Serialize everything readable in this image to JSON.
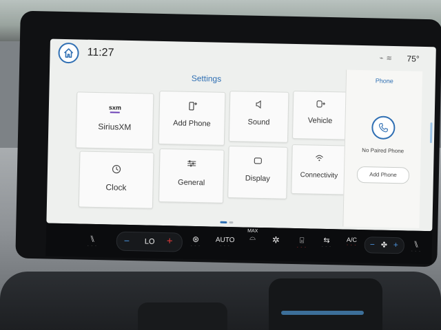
{
  "status_bar": {
    "time": "11:27",
    "outside_temp": "75°",
    "home_icon": "home-icon",
    "status_icons": "wifi-icon, signal-icon"
  },
  "settings": {
    "title": "Settings",
    "tiles": [
      {
        "label": "SiriusXM",
        "icon": "sxm"
      },
      {
        "label": "Add Phone",
        "icon": "phone-add-icon"
      },
      {
        "label": "Sound",
        "icon": "speaker-icon"
      },
      {
        "label": "Vehicle",
        "icon": "vehicle-icon"
      },
      {
        "label": "Clock",
        "icon": "clock-icon"
      },
      {
        "label": "General",
        "icon": "sliders-icon"
      },
      {
        "label": "Display",
        "icon": "display-icon"
      },
      {
        "label": "Connectivity",
        "icon": "wifi-icon"
      }
    ]
  },
  "phone_panel": {
    "title": "Phone",
    "status": "No Paired Phone",
    "button": "Add Phone"
  },
  "controls": {
    "temp_left": "LO",
    "auto": "AUTO",
    "max": "MAX",
    "ac": "A/C"
  },
  "colors": {
    "accent": "#2f6fb3",
    "screen_bg": "#eef0ee",
    "cold": "#4a90d9",
    "hot": "#e03a3a"
  }
}
